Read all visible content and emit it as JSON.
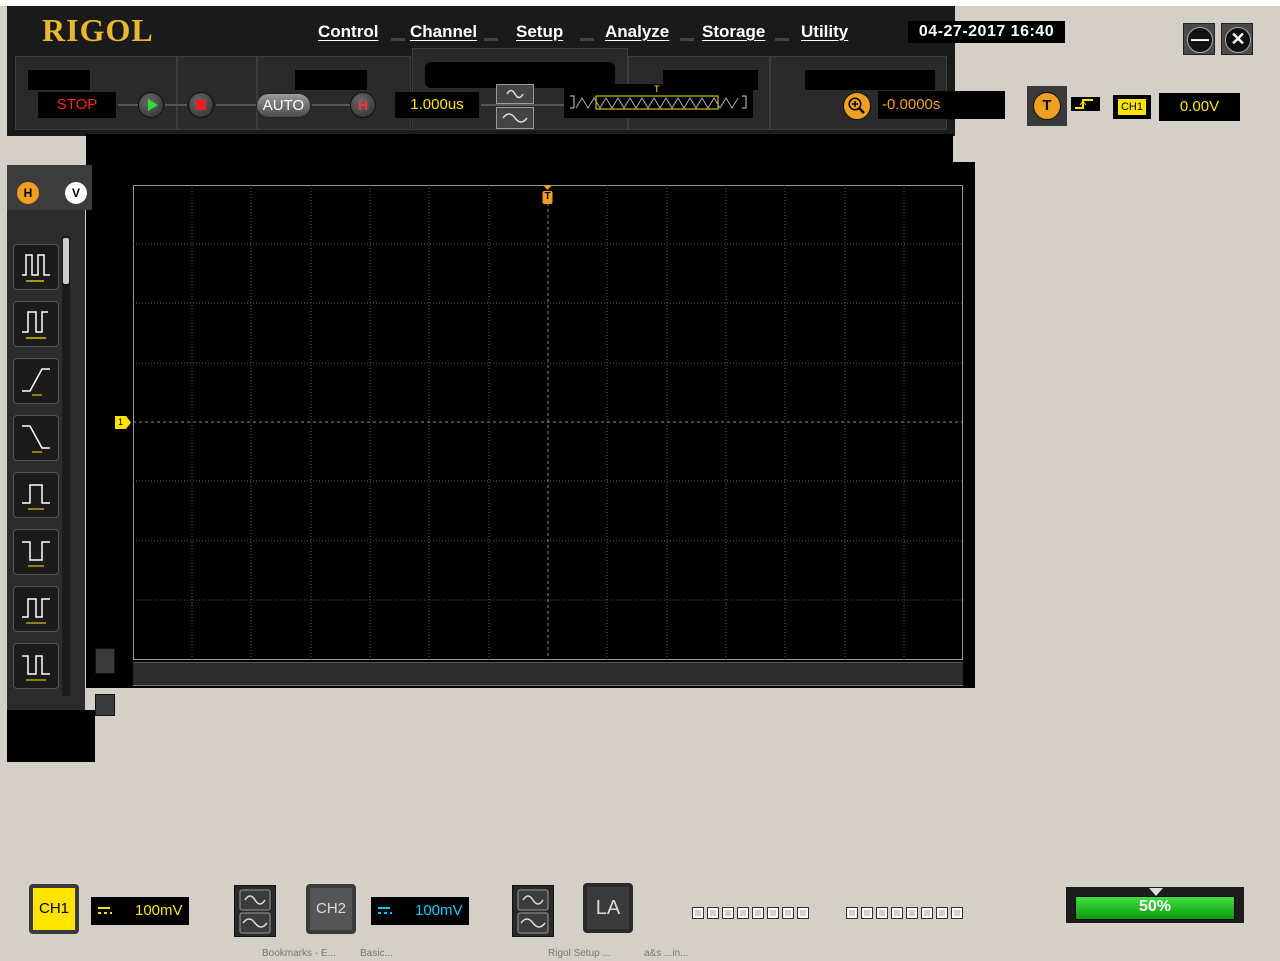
{
  "app": {
    "brand": "RIGOL"
  },
  "menu": [
    "Control",
    "Channel",
    "Setup",
    "Analyze",
    "Storage",
    "Utility"
  ],
  "datetime": "04-27-2017 16:40",
  "run_state": {
    "label": "STOP",
    "color": "#ff2020"
  },
  "auto_label": "AUTO",
  "horizontal": {
    "badge": "H",
    "timebase": "1.000us",
    "zoom_badge": "Q",
    "offset": "-0.0000s"
  },
  "trigger": {
    "badge": "T",
    "channel": "CH1",
    "level": "0.00V",
    "marker": "T"
  },
  "side_tabs": {
    "h": "H",
    "v": "V"
  },
  "channel_marker": "1",
  "channels": [
    {
      "label": "CH1",
      "scale": "100mV",
      "coupling_icon": "dc-coupling-icon",
      "color": "#ffe400"
    },
    {
      "label": "CH2",
      "scale": "100mV",
      "coupling_icon": "dc-coupling-icon",
      "color": "#00c8ff"
    }
  ],
  "la_label": "LA",
  "progress": {
    "label": "50%",
    "value": 0.5
  },
  "taskbar": [
    "Bookmarks - E...",
    "Basic...",
    "Rigol Setup ...",
    "a&s ...in..."
  ],
  "colors": {
    "accent": "#e8b830",
    "ch1": "#ffe400",
    "ch2": "#00c8ff",
    "trigger": "#f0a020",
    "grid": "#5a5a5a"
  }
}
